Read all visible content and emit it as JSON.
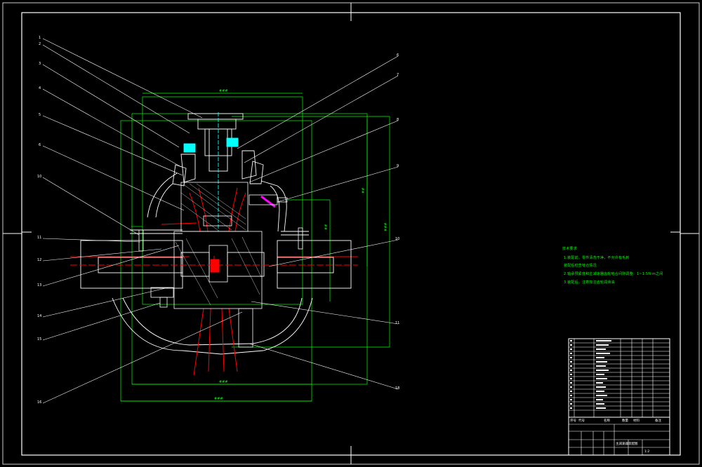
{
  "technical_requirements": {
    "heading": "技术要求",
    "items": [
      "1.装配前，零件清洗干净，不允许有毛刺",
      "装配后检查啮合情况",
      "2.轴承预紧度和主减速器齿轮啮合间隙调整：1~1.5N·m之间",
      "3.装配后，注意加注齿轮润滑油"
    ]
  },
  "title_block": {
    "drawing_title": "主减速器装配图",
    "scale": "1:2",
    "headers": [
      "序号",
      "代号",
      "名称",
      "数量",
      "材料",
      "备注"
    ],
    "rows": 18
  },
  "balloons": {
    "left": [
      "1",
      "2",
      "3",
      "4",
      "5",
      "6",
      "10",
      "11",
      "12",
      "13",
      "14",
      "15",
      "16",
      "17"
    ],
    "right": [
      "6",
      "7",
      "8",
      "9",
      "10",
      "11",
      "18",
      "19"
    ]
  },
  "colors": {
    "background": "#000000",
    "frame": "#ffffff",
    "dimension": "#00ff00",
    "section": "#ff0000",
    "highlight": "#00ffff",
    "outline": "#ffffff",
    "part": "#ff00ff"
  }
}
